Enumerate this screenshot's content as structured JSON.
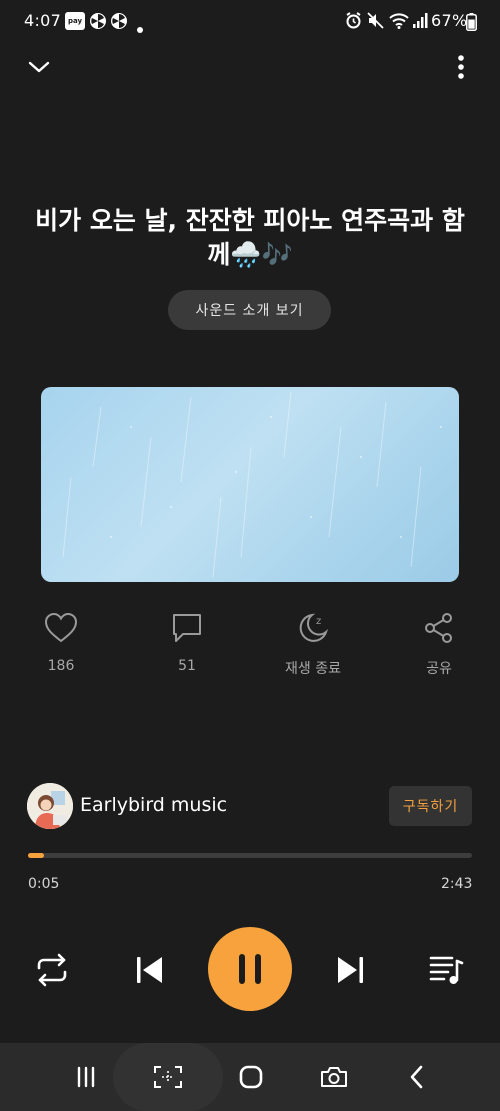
{
  "status_bar": {
    "time": "4:07",
    "pay_label": "pay",
    "battery": "67%"
  },
  "track": {
    "title": "비가 오는 날, 잔잔한 피아노 연주곡과 함께🌧️🎶",
    "sound_intro_label": "사운드 소개 보기"
  },
  "actions": {
    "like_count": "186",
    "comment_count": "51",
    "sleep_timer_label": "재생 종료",
    "share_label": "공유"
  },
  "channel": {
    "name": "Earlybird music",
    "subscribe_label": "구독하기"
  },
  "playback": {
    "current_time": "0:05",
    "total_time": "2:43",
    "progress": 0.035,
    "state": "playing"
  },
  "colors": {
    "accent": "#f7a23c",
    "background": "#1c1c1c",
    "artwork": "#a9d4ec"
  },
  "icons": {
    "collapse": "chevron-down-icon",
    "more": "more-vertical-icon",
    "like": "heart-icon",
    "comment": "comment-icon",
    "sleep": "moon-icon",
    "share": "share-icon",
    "repeat": "repeat-icon",
    "previous": "skip-previous-icon",
    "pause": "pause-icon",
    "next": "skip-next-icon",
    "playlist": "playlist-icon"
  }
}
